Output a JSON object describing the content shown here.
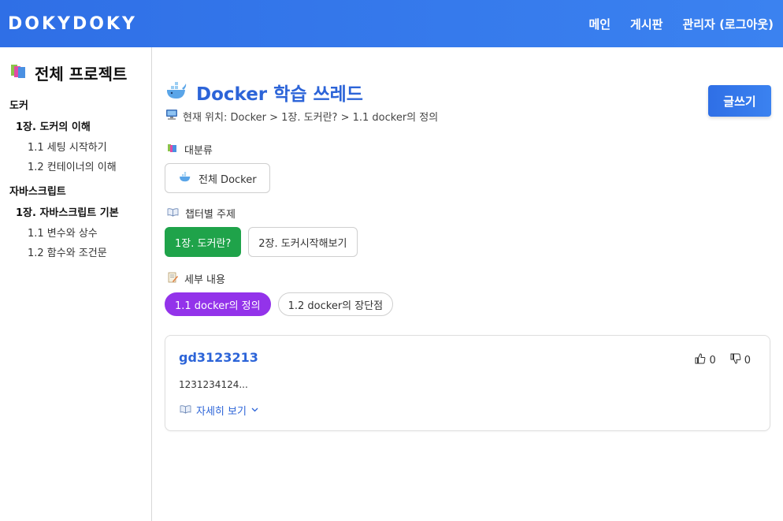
{
  "app": {
    "brand": "DOKYDOKY",
    "nav": [
      "메인",
      "게시판",
      "관리자 (로그아웃)"
    ]
  },
  "sidebar": {
    "title": "전체 프로젝트",
    "groups": [
      {
        "name": "도커",
        "chapters": [
          {
            "name": "1장. 도커의 이해",
            "items": [
              "1.1 세팅 시작하기",
              "1.2 컨테이너의 이해"
            ]
          }
        ]
      },
      {
        "name": "자바스크립트",
        "chapters": [
          {
            "name": "1장. 자바스크립트 기본",
            "items": [
              "1.1 변수와 상수",
              "1.2 함수와 조건문"
            ]
          }
        ]
      }
    ]
  },
  "main": {
    "title": "Docker 학습 쓰레드",
    "breadcrumb": "현재 위치: Docker > 1장. 도커란? > 1.1 docker의 정의",
    "write_button": "글쓰기",
    "category_label": "대분류",
    "categories": [
      "전체 Docker"
    ],
    "chapter_label": "챕터별 주제",
    "chapters": [
      "1장. 도커란?",
      "2장. 도커시작해보기"
    ],
    "detail_label": "세부 내용",
    "details": [
      "1.1 docker의 정의",
      "1.2 docker의 장단점"
    ]
  },
  "post": {
    "title": "gd3123213",
    "likes": "0",
    "dislikes": "0",
    "excerpt": "1231234124...",
    "more_label": "자세히 보기"
  },
  "colors": {
    "accent": "#2f6fe6",
    "title_blue": "#2c64d8",
    "selected_chapter": "#1fa34a",
    "selected_detail": "#9333ea"
  }
}
